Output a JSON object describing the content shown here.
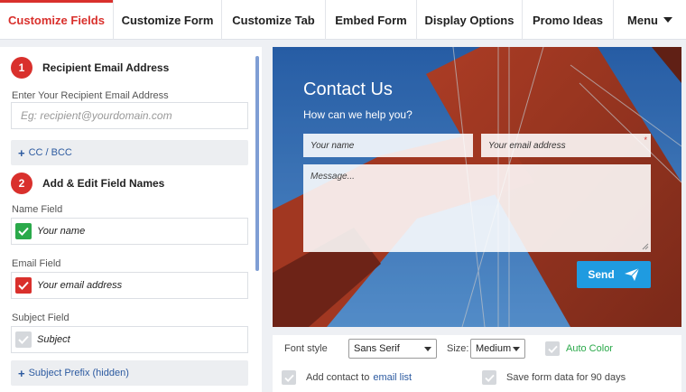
{
  "tabs": [
    {
      "label": "Customize Fields",
      "active": true
    },
    {
      "label": "Customize Form"
    },
    {
      "label": "Customize Tab"
    },
    {
      "label": "Embed Form"
    },
    {
      "label": "Display Options"
    },
    {
      "label": "Promo Ideas"
    },
    {
      "label": "Menu"
    }
  ],
  "left": {
    "section1": {
      "number": "1",
      "title": "Recipient Email Address"
    },
    "recipient_label": "Enter Your Recipient Email Address",
    "recipient_placeholder": "Eg: recipient@yourdomain.com",
    "cc_bcc": "CC / BCC",
    "section2": {
      "number": "2",
      "title": "Add & Edit Field Names"
    },
    "name_label": "Name Field",
    "name_value": "Your name",
    "email_label": "Email Field",
    "email_value": "Your email address",
    "subject_label": "Subject Field",
    "subject_value": "Subject",
    "subject_prefix": "Subject Prefix (hidden)"
  },
  "preview": {
    "title": "Contact Us",
    "subtitle": "How can we help you?",
    "name_placeholder": "Your name",
    "email_placeholder": "Your email address",
    "message_placeholder": "Message...",
    "send_label": "Send"
  },
  "options": {
    "font_style_label": "Font style",
    "font_style_value": "Sans Serif",
    "size_label": "Size:",
    "size_value": "Medium",
    "auto_color": "Auto Color",
    "add_contact_prefix": "Add contact to",
    "add_contact_link": "email list",
    "save_form_data": "Save form data for 90 days"
  },
  "colors": {
    "accent": "#d9302c",
    "link": "#2c5aa0",
    "success": "#2aa94a",
    "send": "#1f9be0"
  }
}
